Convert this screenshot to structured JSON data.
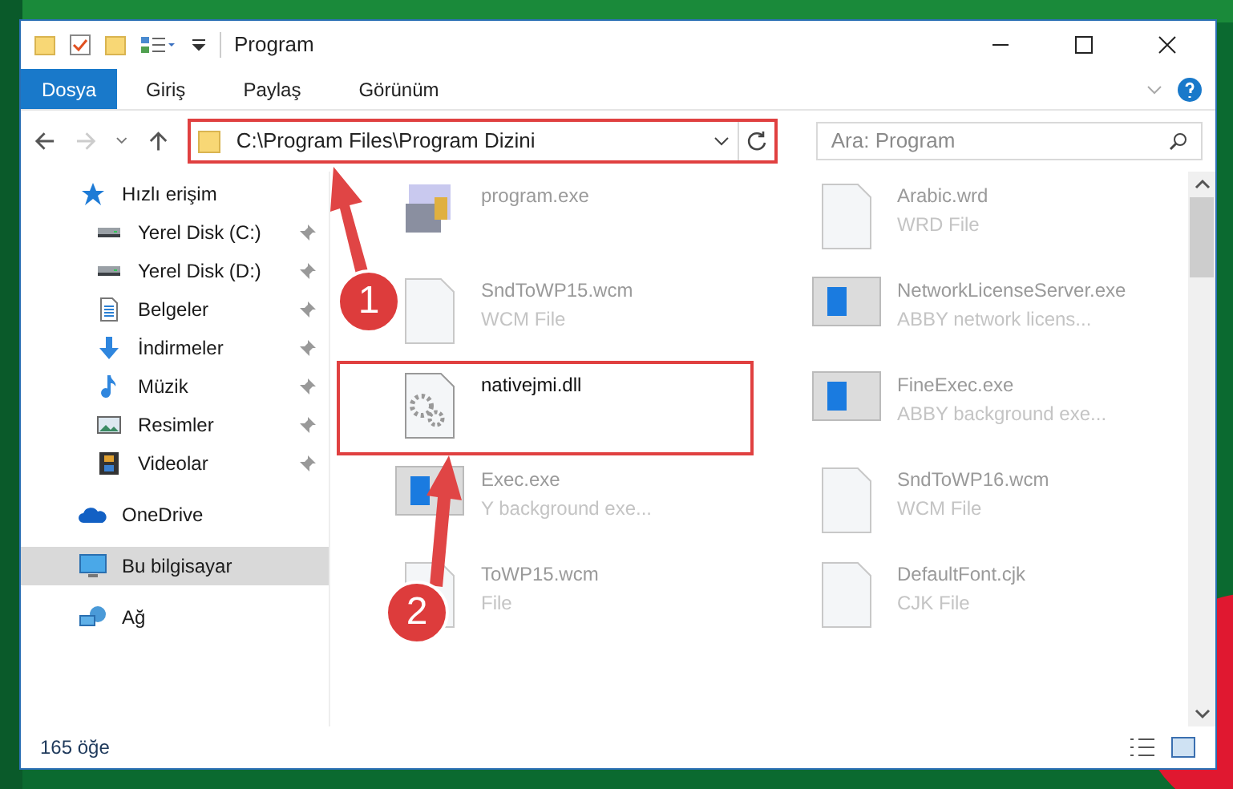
{
  "window": {
    "title": "Program"
  },
  "ribbon_tabs": [
    {
      "label": "Dosya",
      "selected": true
    },
    {
      "label": "Giriş",
      "selected": false
    },
    {
      "label": "Paylaş",
      "selected": false
    },
    {
      "label": "Görünüm",
      "selected": false
    }
  ],
  "address_bar": {
    "path": "C:\\Program Files\\Program Dizini",
    "highlighted": true
  },
  "search": {
    "placeholder": "Ara: Program"
  },
  "sidebar": {
    "items": [
      {
        "label": "Hızlı erişim",
        "kind": "star",
        "selected": false,
        "children": [
          {
            "label": "Yerel Disk (C:)",
            "kind": "drive",
            "pinned": true,
            "selected": false
          },
          {
            "label": "Yerel Disk (D:)",
            "kind": "drive",
            "pinned": true,
            "selected": false
          },
          {
            "label": "Belgeler",
            "kind": "docs",
            "pinned": true,
            "selected": false
          },
          {
            "label": "İndirmeler",
            "kind": "download",
            "pinned": true,
            "selected": false
          },
          {
            "label": "Müzik",
            "kind": "music",
            "pinned": true,
            "selected": false
          },
          {
            "label": "Resimler",
            "kind": "pictures",
            "pinned": true,
            "selected": false
          },
          {
            "label": "Videolar",
            "kind": "videos",
            "pinned": true,
            "selected": false
          }
        ]
      },
      {
        "label": "OneDrive",
        "kind": "cloud",
        "selected": false
      },
      {
        "label": "Bu bilgisayar",
        "kind": "computer",
        "selected": true
      },
      {
        "label": "Ağ",
        "kind": "network",
        "selected": false
      }
    ]
  },
  "files": [
    {
      "name": "program.exe",
      "kind": "app",
      "highlighted": false
    },
    {
      "name": "Arabic.wrd",
      "type": "WRD File",
      "kind": "file",
      "highlighted": false
    },
    {
      "name": "SndToWP15.wcm",
      "type": "WCM File",
      "kind": "file",
      "highlighted": false
    },
    {
      "name": "NetworkLicenseServer.exe",
      "type": "ABBY network licens...",
      "kind": "window",
      "highlighted": false
    },
    {
      "name": "nativejmi.dll",
      "kind": "dll",
      "highlighted": true
    },
    {
      "name": "FineExec.exe",
      "type": "ABBY background exe...",
      "kind": "window",
      "highlighted": false
    },
    {
      "name": "Exec.exe",
      "type": "Y background exe...",
      "kind": "window",
      "highlighted": false
    },
    {
      "name": "SndToWP16.wcm",
      "type": "WCM File",
      "kind": "file",
      "highlighted": false
    },
    {
      "name": "ToWP15.wcm",
      "type": "File",
      "kind": "file",
      "highlighted": false
    },
    {
      "name": "DefaultFont.cjk",
      "type": "CJK File",
      "kind": "file",
      "highlighted": false
    }
  ],
  "status_bar": {
    "count": "165 öğe"
  },
  "annotations": [
    {
      "label": "1"
    },
    {
      "label": "2"
    }
  ]
}
